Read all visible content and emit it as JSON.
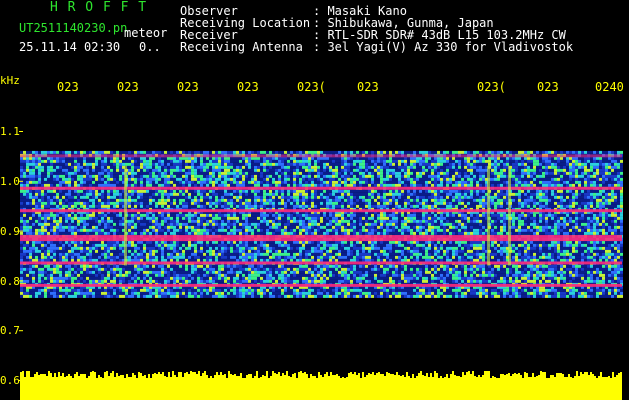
{
  "header": {
    "logo": "H R O F F T",
    "filename": "UT2511140230.pn",
    "mode": "meteor",
    "datetime": "25.11.14 02:30",
    "counter": "0..",
    "info_labels": [
      "Observer",
      "Receiving Location",
      "Receiver",
      "Receiving Antenna"
    ],
    "info_values": [
      ": Masaki Kano",
      ": Shibukawa, Gunma, Japan",
      ": RTL-SDR SDR# 43dB L15 103.2MHz CW",
      ": 3el Yagi(V) Az 330 for Vladivostok"
    ]
  },
  "colors": {
    "background": "#000000",
    "axis": "#ffff00",
    "header_green": "#2ee62e",
    "header_white": "#ffffff",
    "signal_hot": "#ff2a7a",
    "audio_level": "#ffff00"
  },
  "chart_data": {
    "type": "heatmap",
    "ylabel": "kHz",
    "y_ticks": [
      "1.1",
      "1.0",
      "0.9",
      "0.8",
      "0.7",
      "0.6"
    ],
    "y_tick_values": [
      1.1,
      1.0,
      0.9,
      0.8,
      0.7,
      0.6
    ],
    "ylim": [
      0.6,
      1.15
    ],
    "x_ticks": [
      "023",
      "023",
      "023",
      "023",
      "023(",
      "023",
      "023(",
      "023",
      "0240"
    ],
    "signal_lines_khz": [
      1.05,
      0.985,
      0.94,
      0.885,
      0.835,
      0.79
    ],
    "band_khz": [
      0.77,
      1.06
    ],
    "grid": false
  }
}
